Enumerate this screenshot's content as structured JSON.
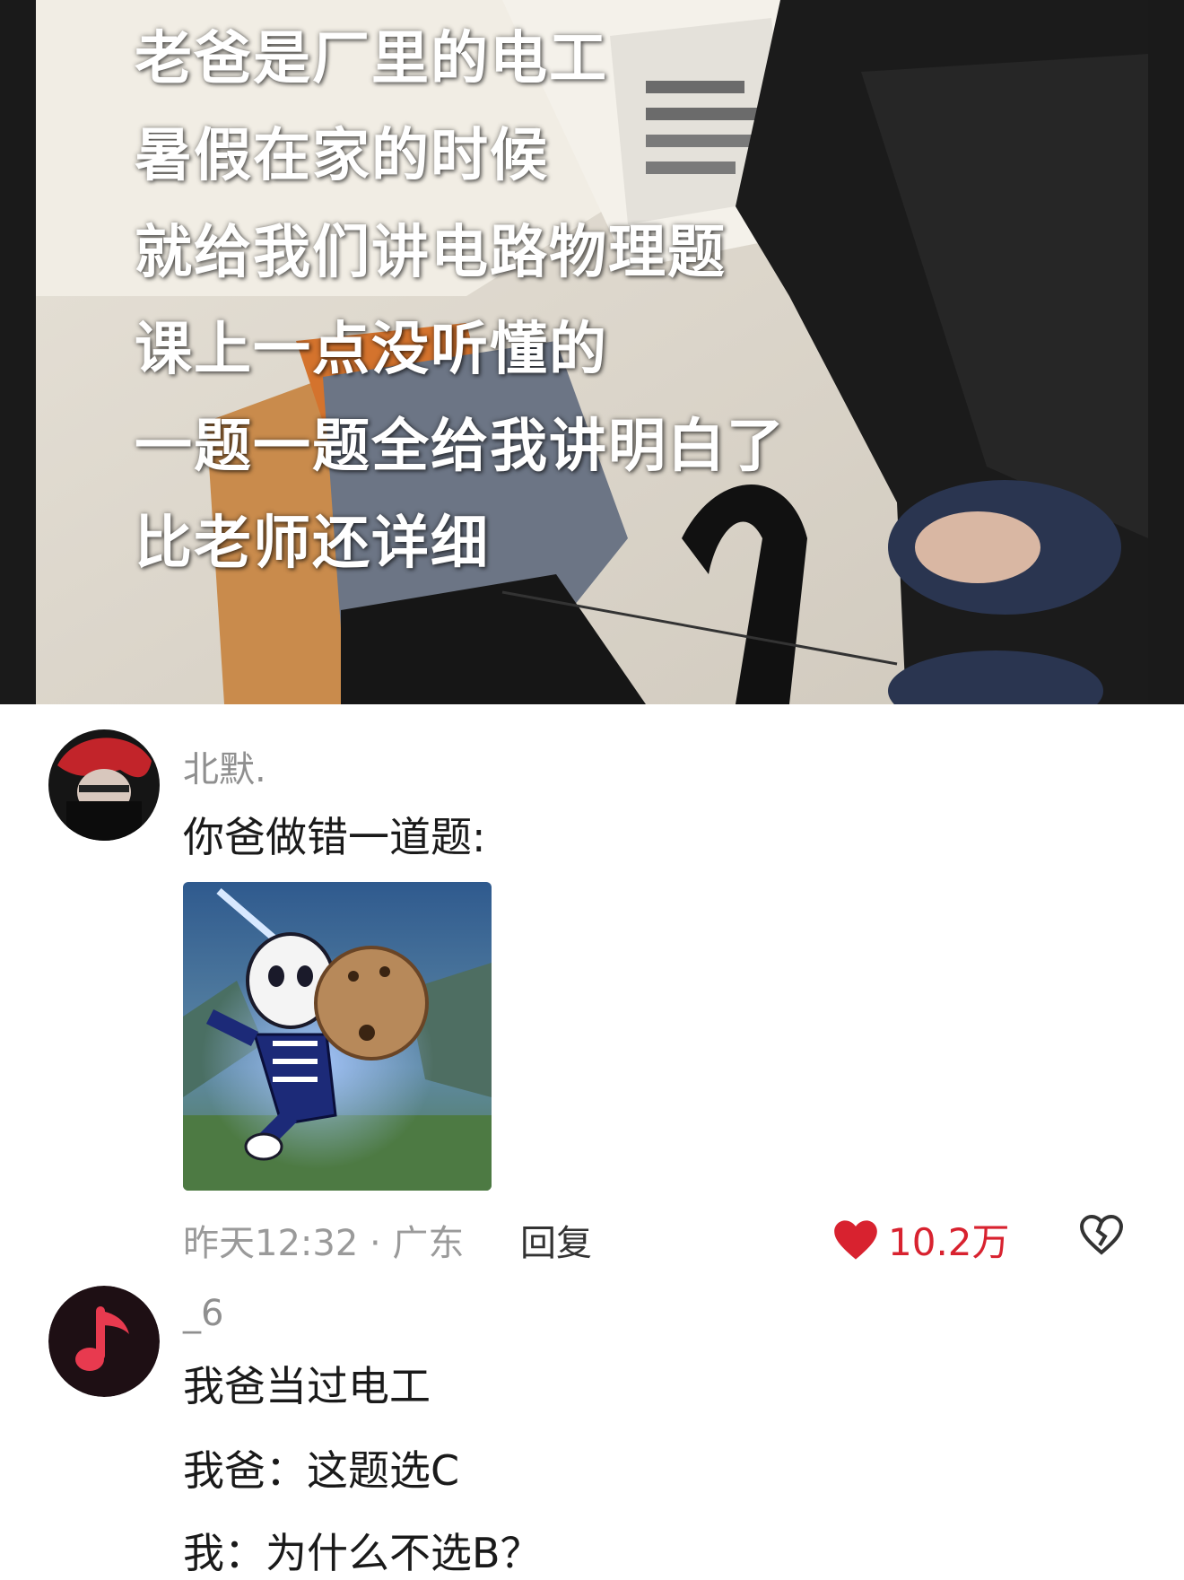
{
  "video": {
    "caption_lines": [
      "老爸是厂里的电工",
      "暑假在家的时候",
      "就给我们讲电路物理题",
      "课上一点没听懂的",
      "一题一题全给我讲明白了",
      "比老师还详细"
    ]
  },
  "comments": [
    {
      "username": "北默.",
      "text": "你爸做错一道题:",
      "has_sticker": true,
      "time": "昨天12:32 · 广东",
      "reply_label": "回复",
      "likes": "10.2万",
      "avatar_icon": "red-hair-avatar"
    },
    {
      "username": "_6",
      "lines": [
        "我爸当过电工",
        "我爸：这题选C",
        "我：为什么不选B？"
      ],
      "avatar_icon": "music-note-avatar"
    }
  ],
  "colors": {
    "like": "#d8222f",
    "music_avatar_bg": "#1e0f14",
    "music_note": "#e83a4f"
  }
}
